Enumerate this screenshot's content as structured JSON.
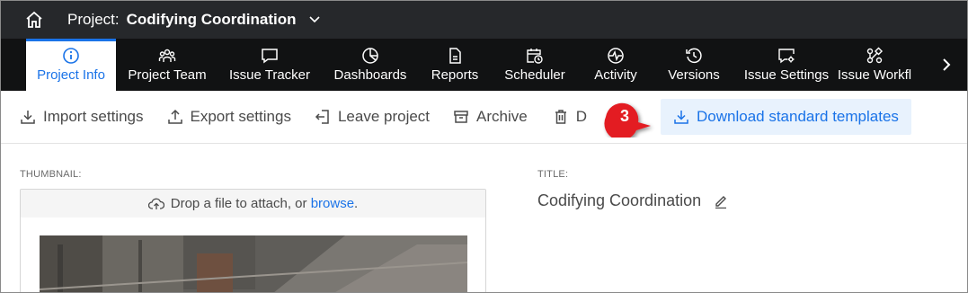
{
  "header": {
    "project_prefix": "Project:",
    "project_name": "Codifying Coordination"
  },
  "tabs": [
    {
      "label": "Project Info",
      "icon": "info-icon",
      "active": true
    },
    {
      "label": "Project Team",
      "icon": "team-icon"
    },
    {
      "label": "Issue Tracker",
      "icon": "chat-icon"
    },
    {
      "label": "Dashboards",
      "icon": "pie-chart-icon"
    },
    {
      "label": "Reports",
      "icon": "document-icon"
    },
    {
      "label": "Scheduler",
      "icon": "calendar-clock-icon"
    },
    {
      "label": "Activity",
      "icon": "pulse-icon"
    },
    {
      "label": "Versions",
      "icon": "history-icon"
    },
    {
      "label": "Issue Settings",
      "icon": "settings-chat-icon"
    },
    {
      "label": "Issue Workfl",
      "icon": "workflow-icon"
    }
  ],
  "toolbar": {
    "import": "Import settings",
    "export": "Export settings",
    "leave": "Leave project",
    "archive": "Archive",
    "delete_partial": "D",
    "download": "Download standard templates"
  },
  "annotation": {
    "step": "3",
    "color": "#e31e24"
  },
  "content": {
    "thumbnail_label": "THUMBNAIL:",
    "drop_text": "Drop a file to attach, or",
    "browse": "browse",
    "browse_suffix": ".",
    "title_label": "TITLE:",
    "title_value": "Codifying Coordination"
  },
  "colors": {
    "header_bg": "#26282b",
    "tabbar_bg": "#111213",
    "accent": "#1a73e8",
    "primary_btn_bg": "#e8f2fd"
  }
}
